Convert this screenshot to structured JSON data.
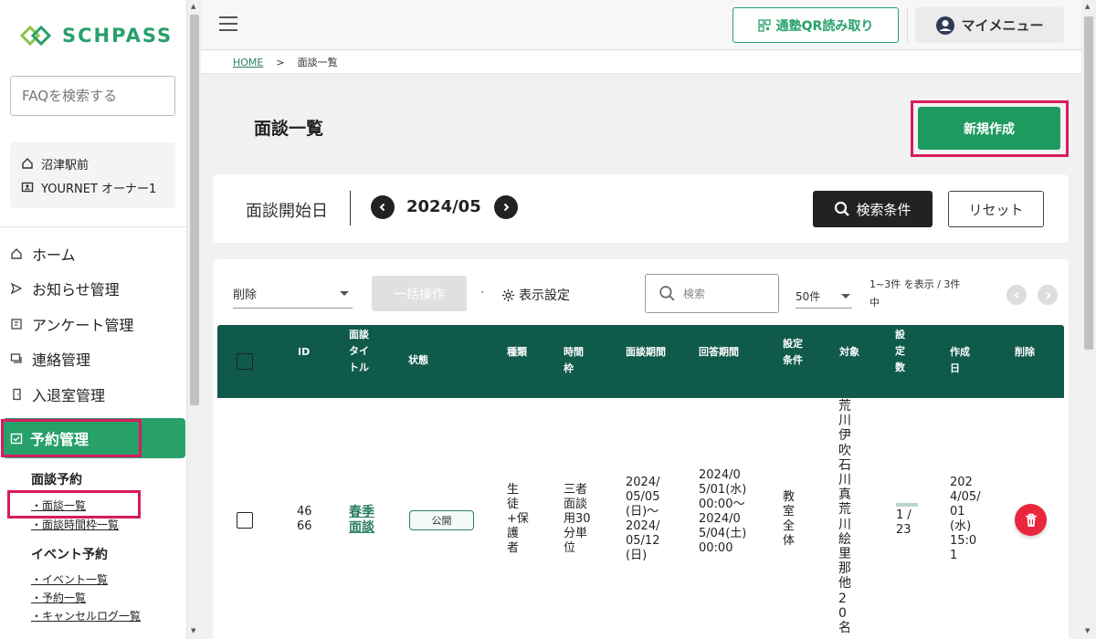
{
  "app": {
    "logo_text": "SCHPASS",
    "accent_color": "#27a06a",
    "highlight_color": "#d81b60"
  },
  "sidebar": {
    "faq_placeholder": "FAQを検索する",
    "school_name": "沼津駅前",
    "user_name": "YOURNET オーナー1",
    "nav": [
      {
        "label": "ホーム",
        "icon": "home-icon"
      },
      {
        "label": "お知らせ管理",
        "icon": "send-icon"
      },
      {
        "label": "アンケート管理",
        "icon": "survey-icon"
      },
      {
        "label": "連絡管理",
        "icon": "chat-icon"
      },
      {
        "label": "入退室管理",
        "icon": "door-icon"
      }
    ],
    "active_nav": "予約管理",
    "sub_sections": [
      {
        "heading": "面談予約",
        "links": [
          "・面談一覧",
          "・面談時間枠一覧"
        ]
      },
      {
        "heading": "イベント予約",
        "links": [
          "・イベント一覧",
          "・予約一覧",
          "・キャンセルログ一覧"
        ]
      }
    ]
  },
  "header": {
    "qr_button": "通塾QR読み取り",
    "my_menu": "マイメニュー"
  },
  "breadcrumb": {
    "home": "HOME",
    "separator": ">",
    "current": "面談一覧"
  },
  "page": {
    "title": "面談一覧",
    "new_button": "新規作成"
  },
  "date_filter": {
    "label": "面談開始日",
    "value": "2024/05",
    "search_button": "検索条件",
    "reset_button": "リセット"
  },
  "toolbar": {
    "action_select": "削除",
    "bulk_button": "一括操作",
    "display_settings": "表示設定",
    "search_placeholder": "検索",
    "per_page": "50件",
    "count_text": "1~3件 を表示 / 3件中"
  },
  "table": {
    "headers": [
      "ID",
      "面談タイトル",
      "状態",
      "種類",
      "時間枠",
      "面談期間",
      "回答期間",
      "設定条件",
      "対象",
      "設定数",
      "作成日",
      "削除"
    ],
    "rows": [
      {
        "id": "4666",
        "title": "春季面談",
        "status": "公開",
        "type": "生徒+保護者",
        "slot": "三者面談用30分単位",
        "period": "2024/05/05(日)～2024/05/12(日)",
        "answer_period": "2024/05/01(水) 00:00～2024/05/04(土) 00:00",
        "condition": "教室全体",
        "target": "荒川伊吹石川真荒川絵里那他20名",
        "count": "1 / 23",
        "created": "2024/05/01(水) 15:01"
      }
    ]
  }
}
